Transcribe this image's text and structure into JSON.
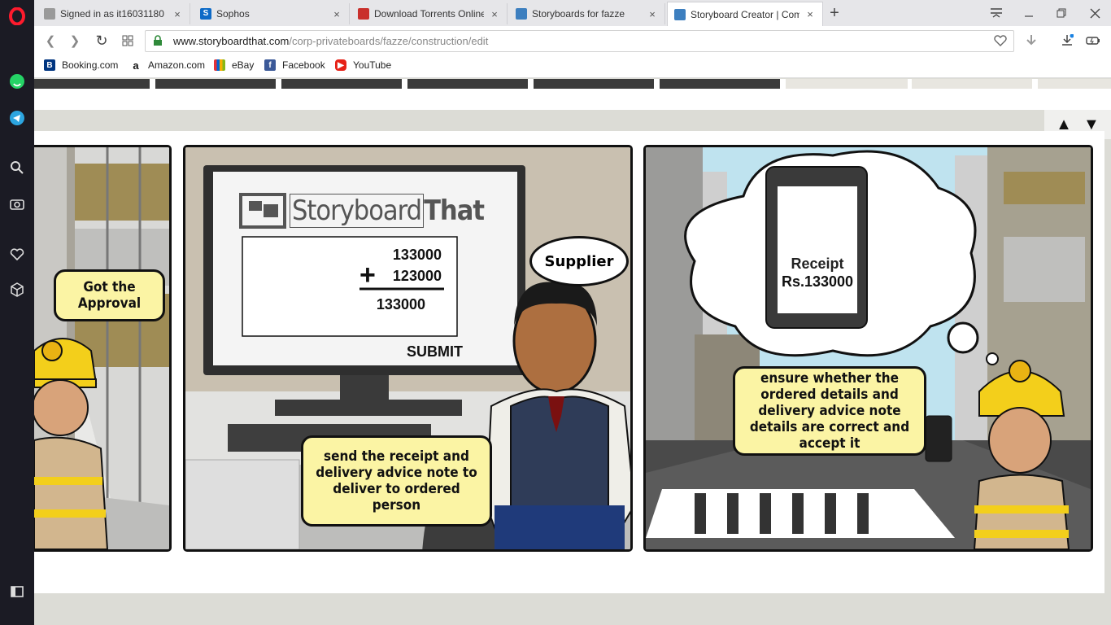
{
  "tabs": [
    {
      "title": "Signed in as it16031180",
      "favicon": "doc-icon",
      "close": "×"
    },
    {
      "title": "Sophos",
      "favicon": "sophos-S-icon",
      "close": "×"
    },
    {
      "title": "Download Torrents Online",
      "favicon": "torrent-icon",
      "close": "×"
    },
    {
      "title": "Storyboards for fazze",
      "favicon": "storyboard-icon",
      "close": "×"
    },
    {
      "title": "Storyboard Creator | Comi",
      "favicon": "storyboard-icon",
      "close": "×",
      "active": true
    }
  ],
  "new_tab": "+",
  "address": {
    "host": "www.storyboardthat.com",
    "path": "/corp-privateboards/fazze/construction/edit"
  },
  "bookmarks": [
    {
      "label": "Booking.com",
      "icon": "B"
    },
    {
      "label": "Amazon.com",
      "icon": "a"
    },
    {
      "label": "eBay",
      "icon": "bag"
    },
    {
      "label": "Facebook",
      "icon": "f"
    },
    {
      "label": "YouTube",
      "icon": "play"
    }
  ],
  "cells": {
    "c1": {
      "speech": "Got the Approval"
    },
    "c2": {
      "logo_left": "Storyboard",
      "logo_right": "That",
      "calc": {
        "a": "133000",
        "op": "+",
        "b": "123000",
        "result": "133000"
      },
      "submit": "SUBMIT",
      "supplier": "Supplier",
      "speech": "send the receipt and delivery advice note to deliver to ordered person"
    },
    "c3": {
      "phone_line1": "Receipt",
      "phone_line2": "Rs.133000",
      "speech": "ensure whether the ordered details and delivery advice note details are correct and accept it"
    }
  },
  "colors": {
    "bubble": "#fbf4a4",
    "sidebar": "#1b1b24",
    "opera": "#ff1b2d"
  }
}
